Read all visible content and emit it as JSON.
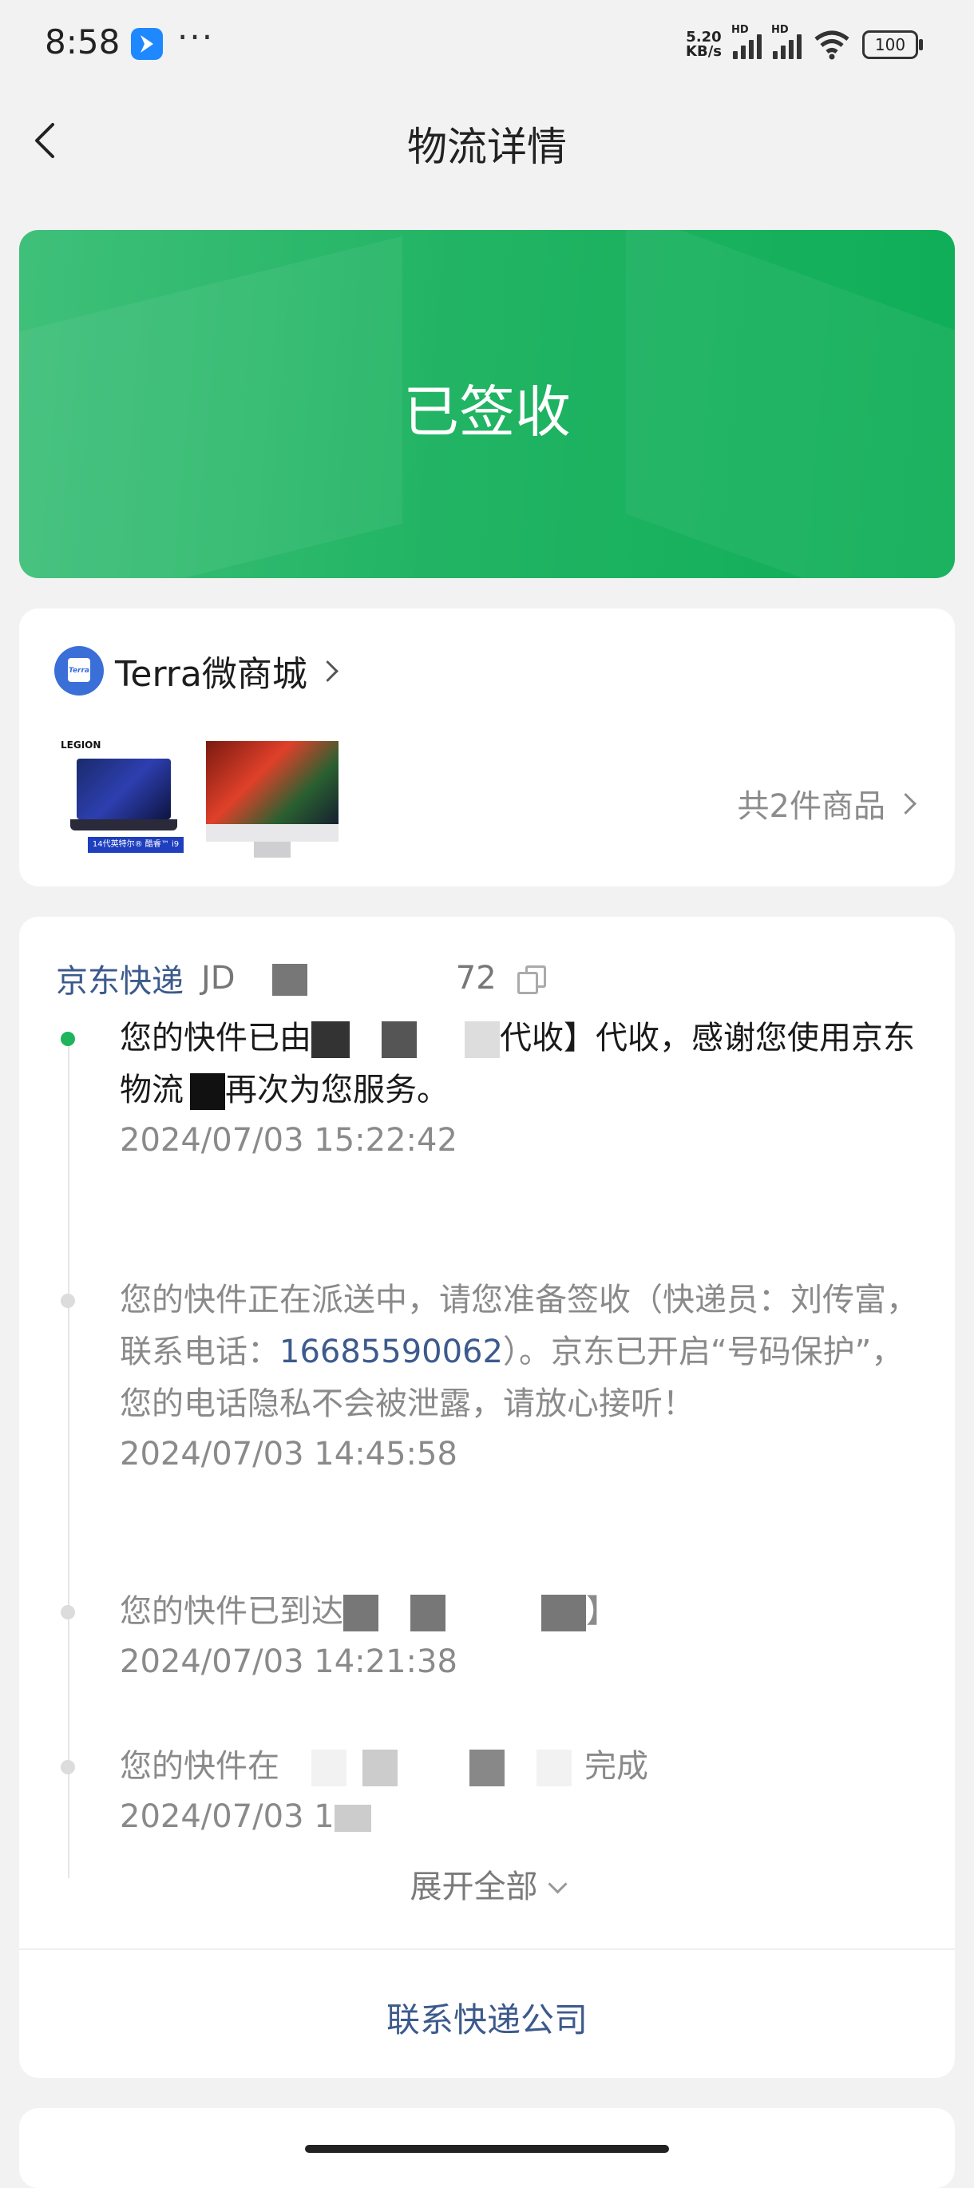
{
  "status_bar": {
    "time": "8:58",
    "more": "···",
    "speed_value": "5.20",
    "speed_unit": "KB/s",
    "signal1_label": "HD",
    "signal2_label": "HD",
    "battery": "100"
  },
  "nav": {
    "title": "物流详情"
  },
  "status_card": {
    "status": "已签收",
    "color": "#1db45c"
  },
  "shop": {
    "name": "Terra微商城",
    "logo_text": "Terra",
    "items_count": "共2件商品",
    "thumb1_logo": "LEGION",
    "thumb1_banner": "14代英特尔® 酷睿™ i9"
  },
  "logistics": {
    "carrier": "京东快递",
    "tracking_prefix": "JD",
    "tracking_suffix": "72",
    "events": [
      {
        "text_a": "您的快件已由",
        "text_b": "代收】代收，感谢您使用京东物流",
        "text_c": "再次为您服务。",
        "time": "2024/07/03 15:22:42"
      },
      {
        "text_a": "您的快件正在派送中，请您准备签收（快递员：刘传富，联系电话：",
        "phone": "16685590062",
        "text_b": "）。京东已开启“号码保护”，您的电话隐私不会被泄露，请放心接听！",
        "time": "2024/07/03 14:45:58"
      },
      {
        "text_a": "您的快件已到达",
        "text_b": "】",
        "time": "2024/07/03 14:21:38"
      },
      {
        "text_a": "您的快件在",
        "text_b": "完成",
        "time": "2024/07/03 1"
      }
    ],
    "expand_label": "展开全部",
    "contact_label": "联系快递公司"
  }
}
